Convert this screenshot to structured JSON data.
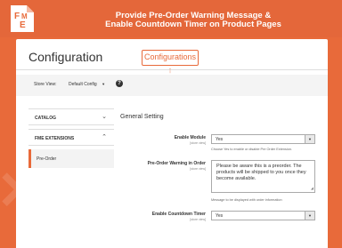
{
  "banner": {
    "title_line1": "Provide Pre-Order Warning Message &",
    "title_line2": "Enable Countdown Timer on Product Pages"
  },
  "page": {
    "title": "Configuration",
    "callout": "Configurations ↑"
  },
  "scope": {
    "label": "Store View:",
    "value": "Default Config",
    "help": "?"
  },
  "sidebar": {
    "items": [
      {
        "label": "CATALOG",
        "chevron": "⌄"
      },
      {
        "label": "FME EXTENSIONS",
        "chevron": "⌃"
      }
    ],
    "sub_item": "Pre-Order"
  },
  "content": {
    "section_title": "General Setting",
    "fields": [
      {
        "label": "Enable Module",
        "scope": "[store view]",
        "value": "Yes",
        "hint": "Choose Yes to enable or disable Pre Order Extension."
      },
      {
        "label": "Pre-Order Warning in Order",
        "scope": "[store view]",
        "value": "Please be aware this is a preorder. The products will be shipped to you once they become available.",
        "hint": "Message to be displayed with order information"
      },
      {
        "label": "Enable Countdown Timer",
        "scope": "[store view]",
        "value": "Yes"
      }
    ]
  },
  "colors": {
    "accent": "#e86a3a",
    "panel": "#ffffff"
  },
  "icons": {
    "help": "help-icon",
    "dropdown": "caret-down-icon",
    "logo": "fme-logo"
  }
}
